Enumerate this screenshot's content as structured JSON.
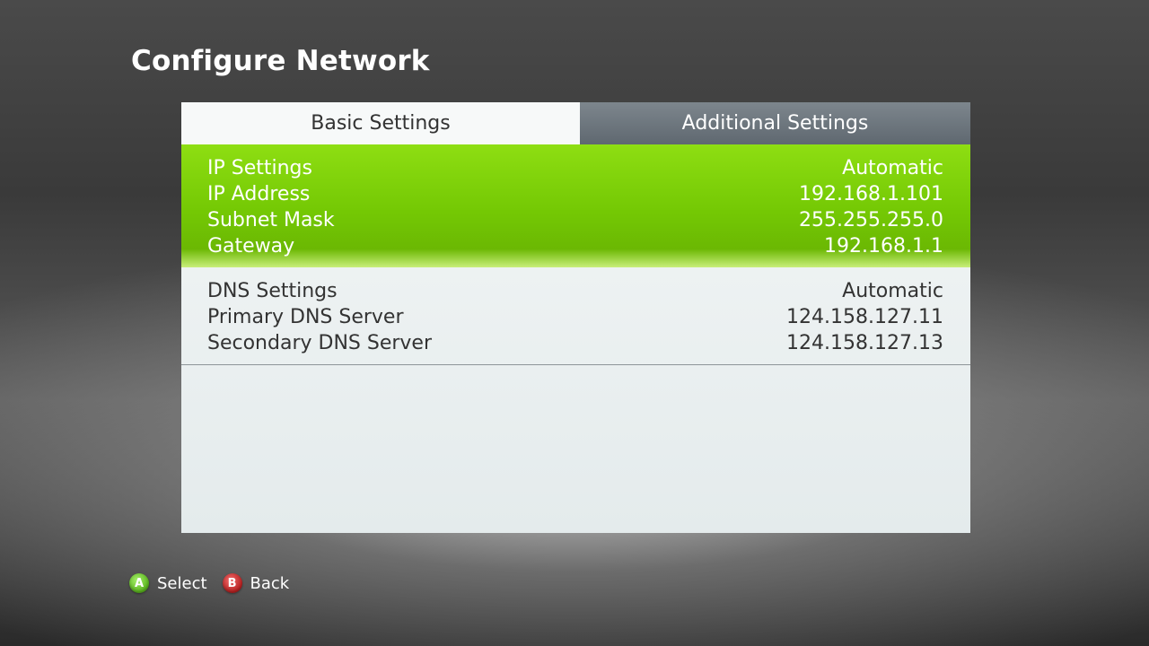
{
  "title": "Configure Network",
  "tabs": {
    "basic": "Basic Settings",
    "additional": "Additional Settings"
  },
  "ip_group": [
    {
      "label": "IP Settings",
      "value": "Automatic"
    },
    {
      "label": "IP Address",
      "value": "192.168.1.101"
    },
    {
      "label": "Subnet Mask",
      "value": "255.255.255.0"
    },
    {
      "label": "Gateway",
      "value": "192.168.1.1"
    }
  ],
  "dns_group": [
    {
      "label": "DNS Settings",
      "value": "Automatic"
    },
    {
      "label": "Primary DNS Server",
      "value": "124.158.127.11"
    },
    {
      "label": "Secondary DNS Server",
      "value": "124.158.127.13"
    }
  ],
  "footer": {
    "a_icon": "A",
    "a_label": "Select",
    "b_icon": "B",
    "b_label": "Back"
  },
  "colors": {
    "selected_group": "#74c804",
    "button_a": "#58b21c",
    "button_b": "#b81f1f"
  }
}
